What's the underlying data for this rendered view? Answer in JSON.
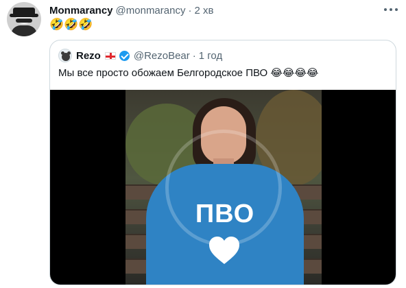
{
  "tweet": {
    "display_name": "Monmarancy",
    "handle": "@monmarancy",
    "separator": "·",
    "time": "2 хв",
    "text": "🤣🤣🤣"
  },
  "quote": {
    "display_name": "Rezo",
    "handle": "@RezoBear",
    "separator": "·",
    "time": "1 год",
    "text": "Мы все просто обожаем Белгородское ПВО 😂😂😂😂",
    "media": {
      "sweater_text": "ПВО"
    }
  },
  "icons": {
    "more": "more-horizontal-icon",
    "verified": "verified-badge-icon",
    "flag": "georgia-flag-icon"
  },
  "colors": {
    "text": "#0f1419",
    "secondary": "#536471",
    "border": "#cfd9de",
    "verified": "#1d9bf0",
    "sweater": "#2f83c4"
  }
}
